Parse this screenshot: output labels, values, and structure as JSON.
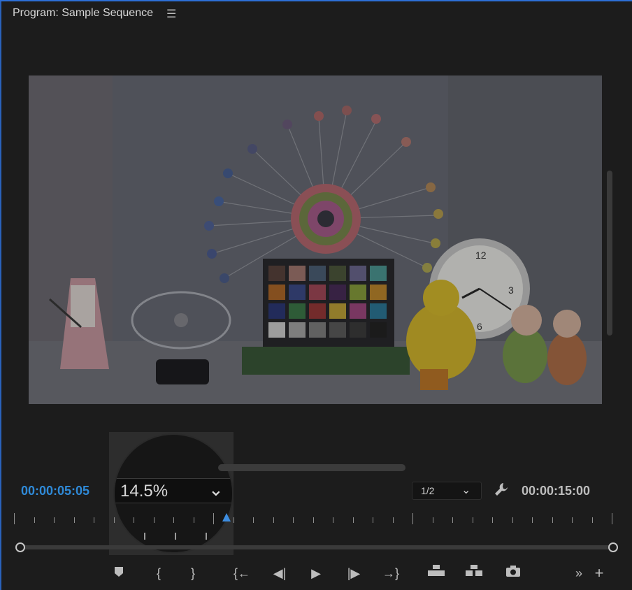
{
  "panel": {
    "title": "Program: Sample Sequence",
    "menu_icon": "hamburger-menu-icon"
  },
  "viewer": {
    "scene": "program monitor video frame"
  },
  "zoom": {
    "value": "14.5%",
    "dropdown_icon": "chevron-down-icon"
  },
  "timecode": {
    "current": "00:00:05:05",
    "duration": "00:00:15:00",
    "current_color": "#2f8ad8"
  },
  "resolution": {
    "value": "1/2",
    "dropdown_icon": "chevron-down-icon"
  },
  "settings_icon": "wrench-icon",
  "transport": {
    "buttons": [
      {
        "name": "add-marker-button",
        "icon": "marker-icon"
      },
      {
        "name": "mark-in-button",
        "icon": "mark-in-icon"
      },
      {
        "name": "mark-out-button",
        "icon": "mark-out-icon"
      },
      {
        "name": "go-to-in-button",
        "icon": "go-to-in-icon"
      },
      {
        "name": "step-back-button",
        "icon": "step-back-icon"
      },
      {
        "name": "play-button",
        "icon": "play-icon"
      },
      {
        "name": "step-forward-button",
        "icon": "step-forward-icon"
      },
      {
        "name": "go-to-out-button",
        "icon": "go-to-out-icon"
      },
      {
        "name": "lift-button",
        "icon": "lift-icon"
      },
      {
        "name": "extract-button",
        "icon": "extract-icon"
      },
      {
        "name": "export-frame-button",
        "icon": "camera-icon"
      },
      {
        "name": "more-controls-button",
        "icon": "double-chevron-right-icon"
      },
      {
        "name": "button-editor-button",
        "icon": "plus-icon"
      }
    ]
  }
}
